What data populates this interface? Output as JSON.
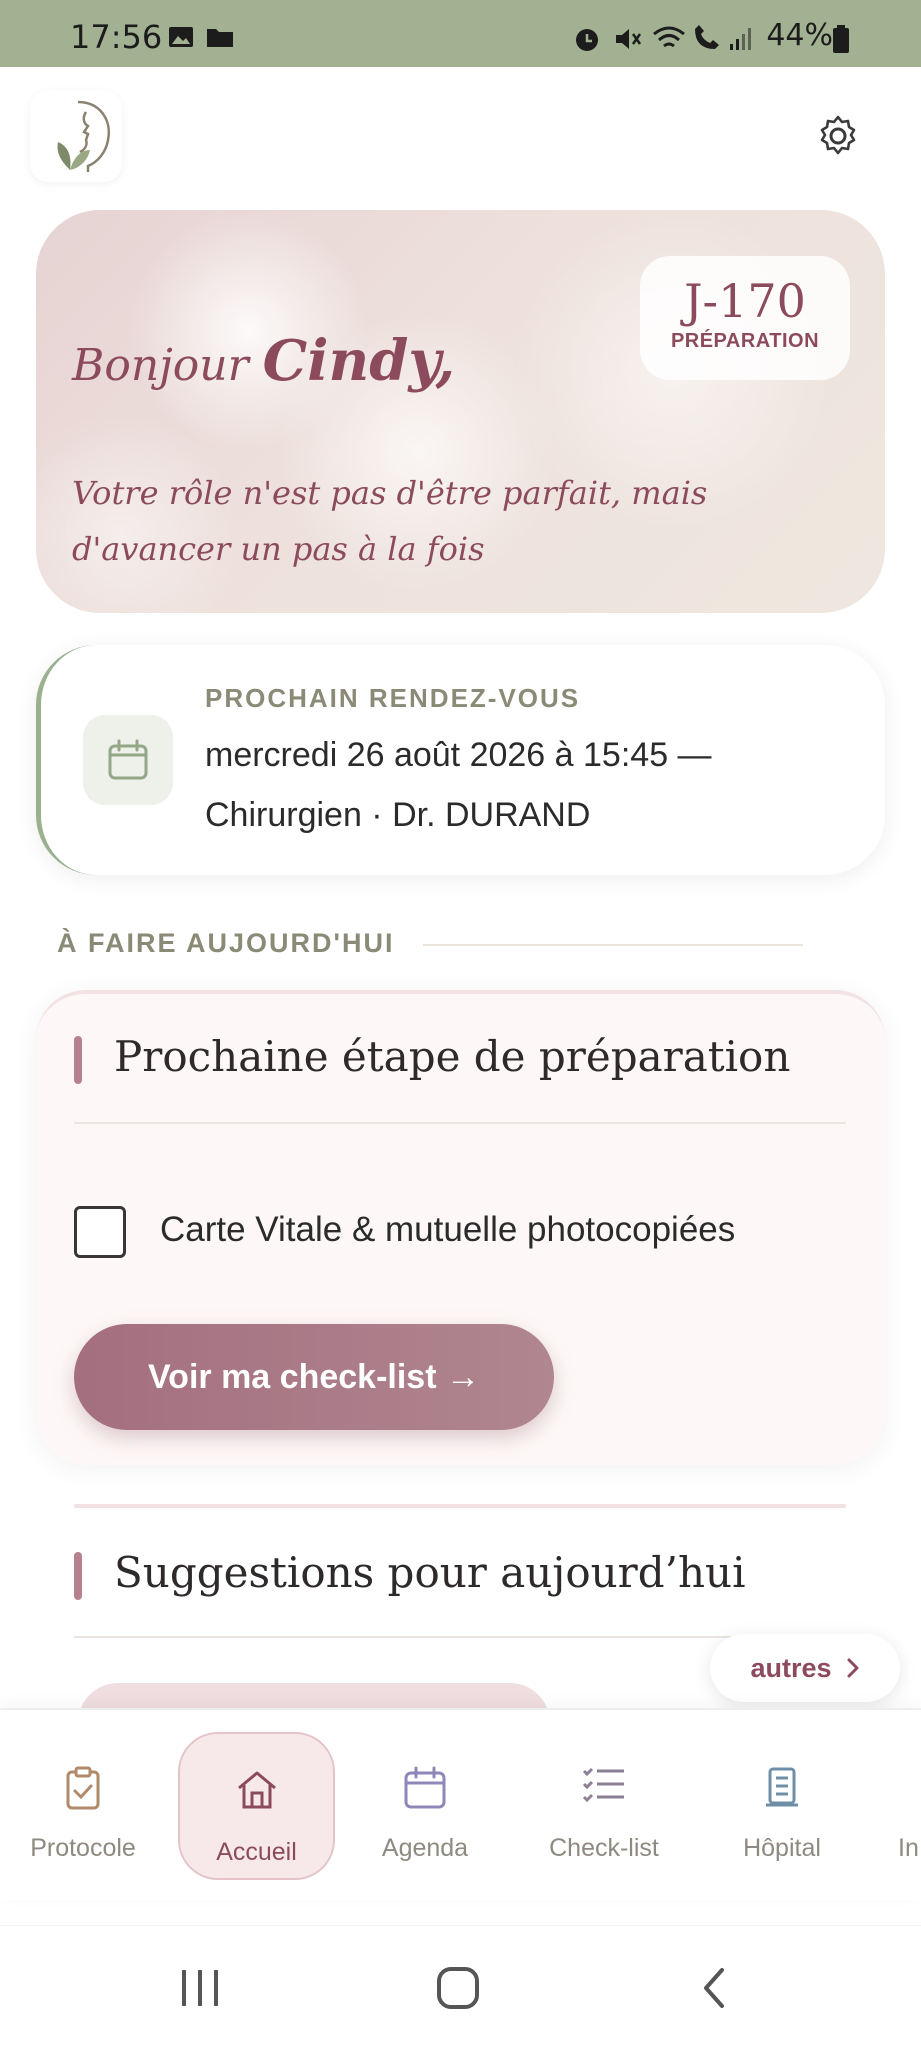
{
  "status_bar": {
    "time": "17:56",
    "battery": "44%"
  },
  "header": {
    "logo_icon": "face-leaf-logo-icon",
    "settings_icon": "gear-icon"
  },
  "hero": {
    "greeting": "Bonjour",
    "name": "Cindy,",
    "quote": "Votre rôle n'est pas d'être parfait, mais d'avancer un pas à la fois",
    "countdown": "J-170",
    "phase": "PRÉPARATION"
  },
  "appointment": {
    "label": "PROCHAIN RENDEZ-VOUS",
    "text": "mercredi 26 août 2026 à 15:45 — Chirurgien · Dr. DURAND",
    "icon": "calendar-icon"
  },
  "today": {
    "section_title": "À FAIRE AUJOURD'HUI"
  },
  "preparation": {
    "title": "Prochaine étape de préparation",
    "task_label": "Carte Vitale & mutuelle photocopiées",
    "task_checked": false,
    "cta_label": "Voir ma check-list →"
  },
  "suggestions": {
    "title": "Suggestions pour aujourd’hui",
    "more_label": "autres"
  },
  "bottom_nav": {
    "items": [
      {
        "label": "Protocole",
        "icon": "clipboard-check-icon"
      },
      {
        "label": "Accueil",
        "icon": "home-icon",
        "active": true
      },
      {
        "label": "Agenda",
        "icon": "calendar-icon"
      },
      {
        "label": "Check-list",
        "icon": "checklist-icon"
      },
      {
        "label": "Hôpital",
        "icon": "hospital-icon"
      },
      {
        "label": "In"
      }
    ]
  },
  "colors": {
    "status_bar": "#a3b193",
    "accent": "#8c4b5c",
    "sage": "#9ab08f",
    "cta": "#a46f7f"
  }
}
